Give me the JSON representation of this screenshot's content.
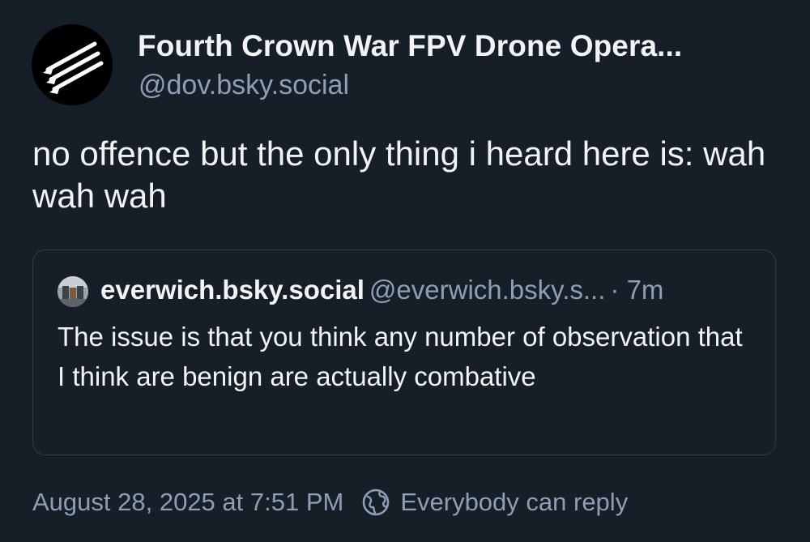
{
  "post": {
    "author": {
      "display_name": "Fourth Crown War FPV Drone Opera...",
      "handle": "@dov.bsky.social",
      "avatar_icon": "three-arrows-icon"
    },
    "text": "no offence but the only thing i heard here is: wah wah wah",
    "quote": {
      "avatar_icon": "photo-avatar",
      "display_name": "everwich.bsky.social",
      "handle": "@everwich.bsky.s...",
      "separator": "·",
      "time": "7m",
      "text": "The issue is that you think any number of observation that I think are benign are actually combative"
    },
    "footer": {
      "timestamp": "August 28, 2025 at 7:51 PM",
      "reply_icon": "globe-icon",
      "reply_setting": "Everybody can reply"
    }
  },
  "colors": {
    "background": "#161e27",
    "text": "#f1f3f5",
    "muted": "#8d9fb5",
    "border": "#2e3b4b"
  }
}
